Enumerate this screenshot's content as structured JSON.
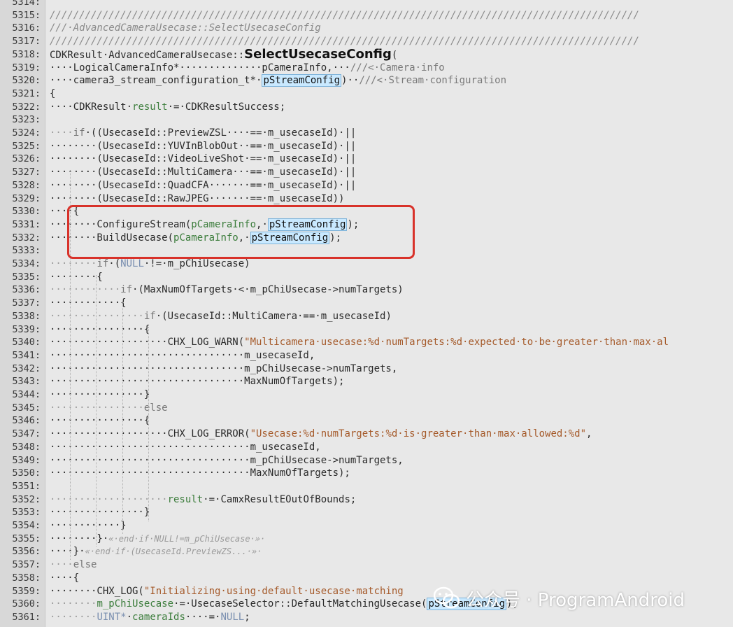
{
  "editor": {
    "lines": [
      {
        "num": "5314:",
        "tokens": [
          {
            "t": "",
            "c": "default"
          }
        ]
      },
      {
        "num": "5315:",
        "tokens": [
          {
            "t": "////////////////////////////////////////////////////////////////////////////////////////////////////",
            "c": "cmt"
          }
        ]
      },
      {
        "num": "5316:",
        "tokens": [
          {
            "t": "///·AdvancedCameraUsecase::SelectUsecaseConfig",
            "c": "cmt"
          }
        ]
      },
      {
        "num": "5317:",
        "tokens": [
          {
            "t": "////////////////////////////////////////////////////////////////////////////////////////////////////",
            "c": "cmt"
          }
        ]
      },
      {
        "num": "5318:",
        "tokens": [
          {
            "t": "CDKResult·AdvancedCameraUsecase::",
            "c": "default"
          },
          {
            "t": "SelectUsecaseConfig",
            "c": "fn"
          },
          {
            "t": "(",
            "c": "default"
          }
        ]
      },
      {
        "num": "5319:",
        "tokens": [
          {
            "t": "····LogicalCameraInfo*··············pCameraInfo,···",
            "c": "default"
          },
          {
            "t": "///<·Camera·info",
            "c": "doc"
          }
        ]
      },
      {
        "num": "5320:",
        "tokens": [
          {
            "t": "····camera3_stream_configuration_t*·",
            "c": "default"
          },
          {
            "t": "pStreamConfig",
            "c": "hl"
          },
          {
            "t": ")··",
            "c": "default"
          },
          {
            "t": "///<·Stream·configuration",
            "c": "doc"
          }
        ]
      },
      {
        "num": "5321:",
        "tokens": [
          {
            "t": "{",
            "c": "default"
          }
        ]
      },
      {
        "num": "5322:",
        "tokens": [
          {
            "t": "····CDKResult·",
            "c": "default"
          },
          {
            "t": "result",
            "c": "var"
          },
          {
            "t": "·=·CDKResultSuccess;",
            "c": "default"
          }
        ]
      },
      {
        "num": "5323:",
        "tokens": [
          {
            "t": "",
            "c": "default"
          }
        ]
      },
      {
        "num": "5324:",
        "tokens": [
          {
            "t": "····",
            "c": "ws"
          },
          {
            "t": "if",
            "c": "kw"
          },
          {
            "t": "·((UsecaseId::PreviewZSL····==·m_usecaseId)·||",
            "c": "default"
          }
        ]
      },
      {
        "num": "5325:",
        "tokens": [
          {
            "t": "········(UsecaseId::YUVInBlobOut··==·m_usecaseId)·||",
            "c": "default"
          }
        ]
      },
      {
        "num": "5326:",
        "tokens": [
          {
            "t": "········(UsecaseId::VideoLiveShot·==·m_usecaseId)·||",
            "c": "default"
          }
        ]
      },
      {
        "num": "5327:",
        "tokens": [
          {
            "t": "········(UsecaseId::MultiCamera···==·m_usecaseId)·||",
            "c": "default"
          }
        ]
      },
      {
        "num": "5328:",
        "tokens": [
          {
            "t": "········(UsecaseId::QuadCFA·······==·m_usecaseId)·||",
            "c": "default"
          }
        ]
      },
      {
        "num": "5329:",
        "tokens": [
          {
            "t": "········(UsecaseId::RawJPEG·······==·m_usecaseId))",
            "c": "default"
          }
        ]
      },
      {
        "num": "5330:",
        "tokens": [
          {
            "t": "····{",
            "c": "default"
          }
        ]
      },
      {
        "num": "5331:",
        "tokens": [
          {
            "t": "········ConfigureStream(",
            "c": "default"
          },
          {
            "t": "pCameraInfo",
            "c": "var"
          },
          {
            "t": ",·",
            "c": "default"
          },
          {
            "t": "pStreamConfig",
            "c": "hl"
          },
          {
            "t": ");",
            "c": "default"
          }
        ]
      },
      {
        "num": "5332:",
        "tokens": [
          {
            "t": "········BuildUsecase(",
            "c": "default"
          },
          {
            "t": "pCameraInfo",
            "c": "var"
          },
          {
            "t": ",·",
            "c": "default"
          },
          {
            "t": "pStreamConfig",
            "c": "hl"
          },
          {
            "t": ");",
            "c": "default"
          }
        ]
      },
      {
        "num": "5333:",
        "tokens": [
          {
            "t": "",
            "c": "default"
          }
        ]
      },
      {
        "num": "5334:",
        "tokens": [
          {
            "t": "········",
            "c": "ws"
          },
          {
            "t": "if",
            "c": "kw"
          },
          {
            "t": "·(",
            "c": "default"
          },
          {
            "t": "NULL",
            "c": "const"
          },
          {
            "t": "·!=·m_pChiUsecase)",
            "c": "default"
          }
        ]
      },
      {
        "num": "5335:",
        "tokens": [
          {
            "t": "········{",
            "c": "default"
          }
        ]
      },
      {
        "num": "5336:",
        "tokens": [
          {
            "t": "············",
            "c": "ws"
          },
          {
            "t": "if",
            "c": "kw"
          },
          {
            "t": "·(MaxNumOfTargets·<·m_pChiUsecase->numTargets)",
            "c": "default"
          }
        ]
      },
      {
        "num": "5337:",
        "tokens": [
          {
            "t": "············{",
            "c": "default"
          }
        ]
      },
      {
        "num": "5338:",
        "tokens": [
          {
            "t": "················",
            "c": "ws"
          },
          {
            "t": "if",
            "c": "kw"
          },
          {
            "t": "·(UsecaseId::MultiCamera·==·m_usecaseId)",
            "c": "default"
          }
        ]
      },
      {
        "num": "5339:",
        "tokens": [
          {
            "t": "················{",
            "c": "default"
          }
        ]
      },
      {
        "num": "5340:",
        "tokens": [
          {
            "t": "····················CHX_LOG_WARN(",
            "c": "default"
          },
          {
            "t": "\"Multicamera·usecase:%d·numTargets:%d·expected·to·be·greater·than·max·al",
            "c": "str"
          }
        ]
      },
      {
        "num": "5341:",
        "tokens": [
          {
            "t": "·································m_usecaseId,",
            "c": "default"
          }
        ]
      },
      {
        "num": "5342:",
        "tokens": [
          {
            "t": "·································m_pChiUsecase->numTargets,",
            "c": "default"
          }
        ]
      },
      {
        "num": "5343:",
        "tokens": [
          {
            "t": "·································MaxNumOfTargets);",
            "c": "default"
          }
        ]
      },
      {
        "num": "5344:",
        "tokens": [
          {
            "t": "················}",
            "c": "default"
          }
        ]
      },
      {
        "num": "5345:",
        "tokens": [
          {
            "t": "················",
            "c": "ws"
          },
          {
            "t": "else",
            "c": "kw"
          }
        ]
      },
      {
        "num": "5346:",
        "tokens": [
          {
            "t": "················{",
            "c": "default"
          }
        ]
      },
      {
        "num": "5347:",
        "tokens": [
          {
            "t": "····················CHX_LOG_ERROR(",
            "c": "default"
          },
          {
            "t": "\"Usecase:%d·numTargets:%d·is·greater·than·max·allowed:%d\"",
            "c": "str"
          },
          {
            "t": ",",
            "c": "default"
          }
        ]
      },
      {
        "num": "5348:",
        "tokens": [
          {
            "t": "··································m_usecaseId,",
            "c": "default"
          }
        ]
      },
      {
        "num": "5349:",
        "tokens": [
          {
            "t": "··································m_pChiUsecase->numTargets,",
            "c": "default"
          }
        ]
      },
      {
        "num": "5350:",
        "tokens": [
          {
            "t": "··································MaxNumOfTargets);",
            "c": "default"
          }
        ]
      },
      {
        "num": "5351:",
        "tokens": [
          {
            "t": "",
            "c": "default"
          }
        ]
      },
      {
        "num": "5352:",
        "tokens": [
          {
            "t": "····················",
            "c": "ws"
          },
          {
            "t": "result",
            "c": "var"
          },
          {
            "t": "·=·CamxResultEOutOfBounds;",
            "c": "default"
          }
        ]
      },
      {
        "num": "5353:",
        "tokens": [
          {
            "t": "················}",
            "c": "default"
          }
        ]
      },
      {
        "num": "5354:",
        "tokens": [
          {
            "t": "············}",
            "c": "default"
          }
        ]
      },
      {
        "num": "5355:",
        "tokens": [
          {
            "t": "········}·",
            "c": "default"
          },
          {
            "t": "«·end·if·NULL!=m_pChiUsecase·»·",
            "c": "fold"
          }
        ]
      },
      {
        "num": "5356:",
        "tokens": [
          {
            "t": "····}·",
            "c": "default"
          },
          {
            "t": "«·end·if·(UsecaseId.PreviewZS...·»·",
            "c": "fold"
          }
        ]
      },
      {
        "num": "5357:",
        "tokens": [
          {
            "t": "····",
            "c": "ws"
          },
          {
            "t": "else",
            "c": "kw"
          }
        ]
      },
      {
        "num": "5358:",
        "tokens": [
          {
            "t": "····{",
            "c": "default"
          }
        ]
      },
      {
        "num": "5359:",
        "tokens": [
          {
            "t": "········CHX_LOG(",
            "c": "default"
          },
          {
            "t": "\"Initializing·using·default·usecase·matching",
            "c": "str"
          }
        ]
      },
      {
        "num": "5360:",
        "tokens": [
          {
            "t": "········",
            "c": "ws"
          },
          {
            "t": "m_pChiUsecase",
            "c": "var"
          },
          {
            "t": "·=·UsecaseSelector::DefaultMatchingUsecase(",
            "c": "default"
          },
          {
            "t": "pStreamConfig",
            "c": "hl"
          },
          {
            "t": ");",
            "c": "default"
          }
        ]
      },
      {
        "num": "5361:",
        "tokens": [
          {
            "t": "········",
            "c": "ws"
          },
          {
            "t": "UINT*",
            "c": "const"
          },
          {
            "t": "·",
            "c": "default"
          },
          {
            "t": "cameraIds",
            "c": "var"
          },
          {
            "t": "····=·",
            "c": "default"
          },
          {
            "t": "NULL",
            "c": "const"
          },
          {
            "t": ";",
            "c": "default"
          }
        ]
      }
    ]
  },
  "watermark": {
    "text": "公众号 · ProgramAndroid",
    "icon": "wechat-logo-icon"
  },
  "annotation": {
    "color": "#d8322a"
  }
}
